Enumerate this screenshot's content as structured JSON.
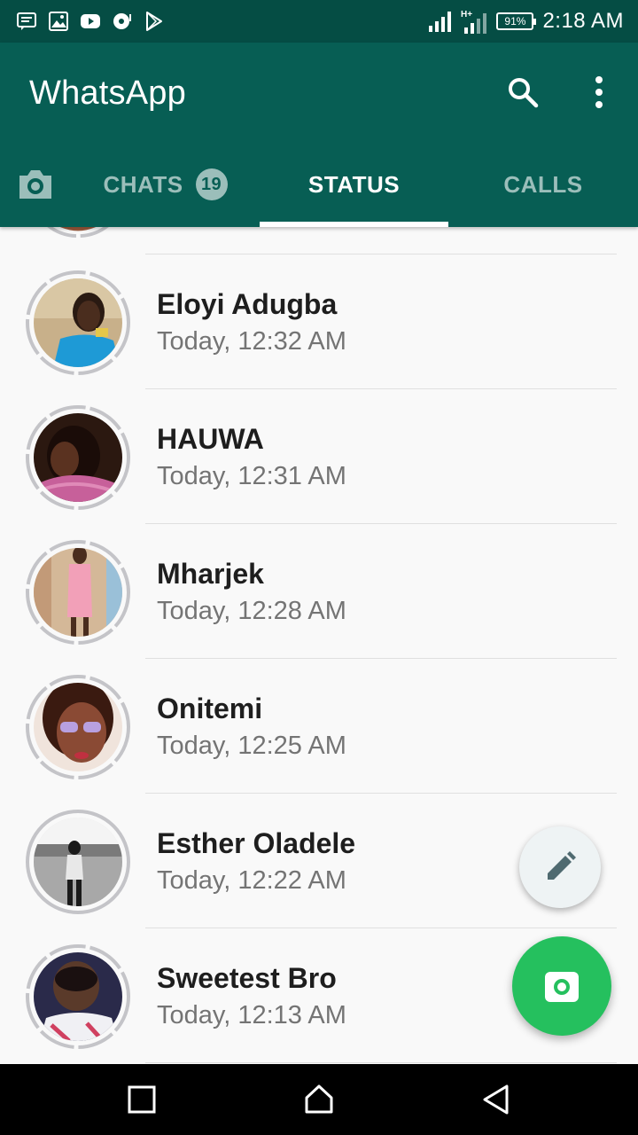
{
  "status_bar": {
    "time": "2:18 AM",
    "battery": "91%",
    "network": "H+",
    "notification_icons": [
      "message-icon",
      "image-icon",
      "youtube-icon",
      "music-icon",
      "play-store-icon"
    ]
  },
  "app_bar": {
    "title": "WhatsApp",
    "icons": [
      "search-icon",
      "more-vert-icon"
    ]
  },
  "tabs": [
    {
      "label": "CHATS",
      "badge": "19",
      "selected": false
    },
    {
      "label": "STATUS",
      "selected": true
    },
    {
      "label": "CALLS",
      "selected": false
    }
  ],
  "status_list": [
    {
      "name": "Eloyi Adugba",
      "time": "Today, 12:32 AM"
    },
    {
      "name": "HAUWA",
      "time": "Today, 12:31 AM"
    },
    {
      "name": "Mharjek",
      "time": "Today, 12:28 AM"
    },
    {
      "name": "Onitemi",
      "time": "Today, 12:25 AM"
    },
    {
      "name": "Esther Oladele",
      "time": "Today, 12:22 AM"
    },
    {
      "name": "Sweetest Bro",
      "time": "Today, 12:13 AM"
    }
  ],
  "fabs": [
    "pencil-icon",
    "camera-icon"
  ],
  "nav_bar": [
    "recents-square-icon",
    "home-icon",
    "back-triangle-icon"
  ],
  "colors": {
    "primary": "#075e54",
    "primary_dark": "#054d44",
    "fab_green": "#25c05e"
  }
}
